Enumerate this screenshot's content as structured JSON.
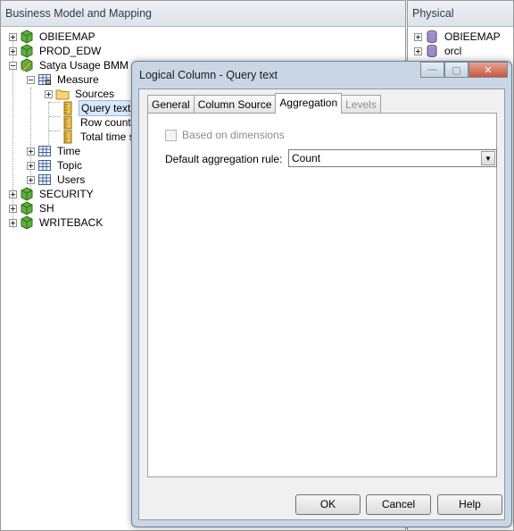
{
  "left_panel": {
    "title": "Business Model and Mapping",
    "tree": {
      "obieemap": "OBIEEMAP",
      "prod_edw": "PROD_EDW",
      "satya": "Satya Usage BMM",
      "measure": "Measure",
      "sources": "Sources",
      "query_text": "Query text",
      "row_count": "Row count",
      "total_time": "Total time se",
      "time": "Time",
      "topic": "Topic",
      "users": "Users",
      "security": "SECURITY",
      "sh": "SH",
      "writeback": "WRITEBACK"
    }
  },
  "right_panel": {
    "title": "Physical",
    "tree": {
      "obieemap": "OBIEEMAP",
      "orcl": "orcl"
    }
  },
  "dialog": {
    "title": "Logical Column - Query text",
    "tabs": {
      "general": "General",
      "column_source": "Column Source",
      "aggregation": "Aggregation",
      "levels": "Levels"
    },
    "based_on_dimensions_label": "Based on dimensions",
    "default_rule_label": "Default aggregation rule:",
    "default_rule_value": "Count",
    "buttons": {
      "ok": "OK",
      "cancel": "Cancel",
      "help": "Help"
    }
  },
  "colors": {
    "dialog_frame": "#c8d6e6",
    "selection": "#d9e8fb",
    "close_button": "#c8553f"
  }
}
